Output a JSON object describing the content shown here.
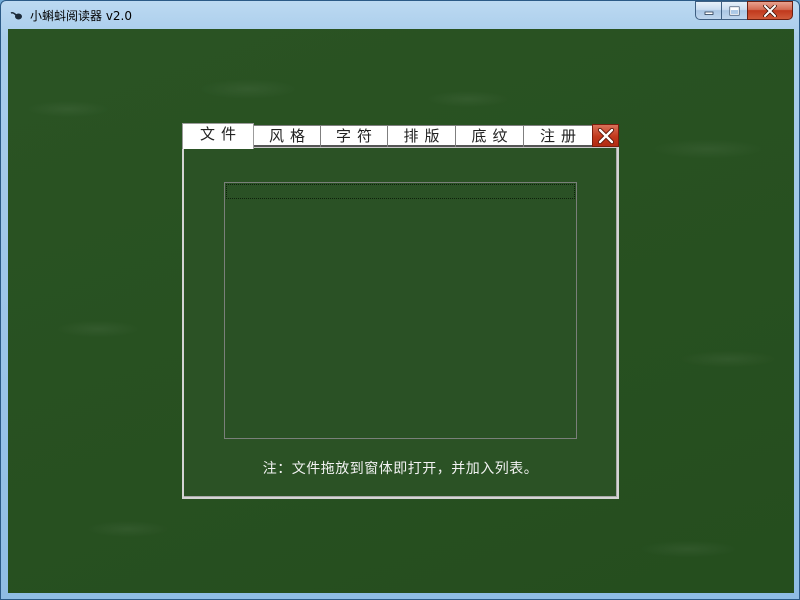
{
  "window": {
    "title": "小蝌蚪阅读器 v2.0",
    "icon": "tadpole-icon",
    "controls": {
      "minimize_icon": "minimize-icon",
      "maximize_icon": "maximize-icon",
      "close_icon": "close-icon"
    }
  },
  "panel": {
    "tabs": [
      {
        "label": "文件",
        "active": true
      },
      {
        "label": "风格",
        "active": false
      },
      {
        "label": "字符",
        "active": false
      },
      {
        "label": "排版",
        "active": false
      },
      {
        "label": "底纹",
        "active": false
      },
      {
        "label": "注册",
        "active": false
      }
    ],
    "close_icon": "close-icon",
    "file_list": {
      "items": []
    },
    "hint": "注：文件拖放到窗体即打开，并加入列表。"
  },
  "colors": {
    "background": "#26501f",
    "panel_body": "#2b5225",
    "close_red": "#c2391c",
    "hint_text": "#f2f2f2"
  }
}
